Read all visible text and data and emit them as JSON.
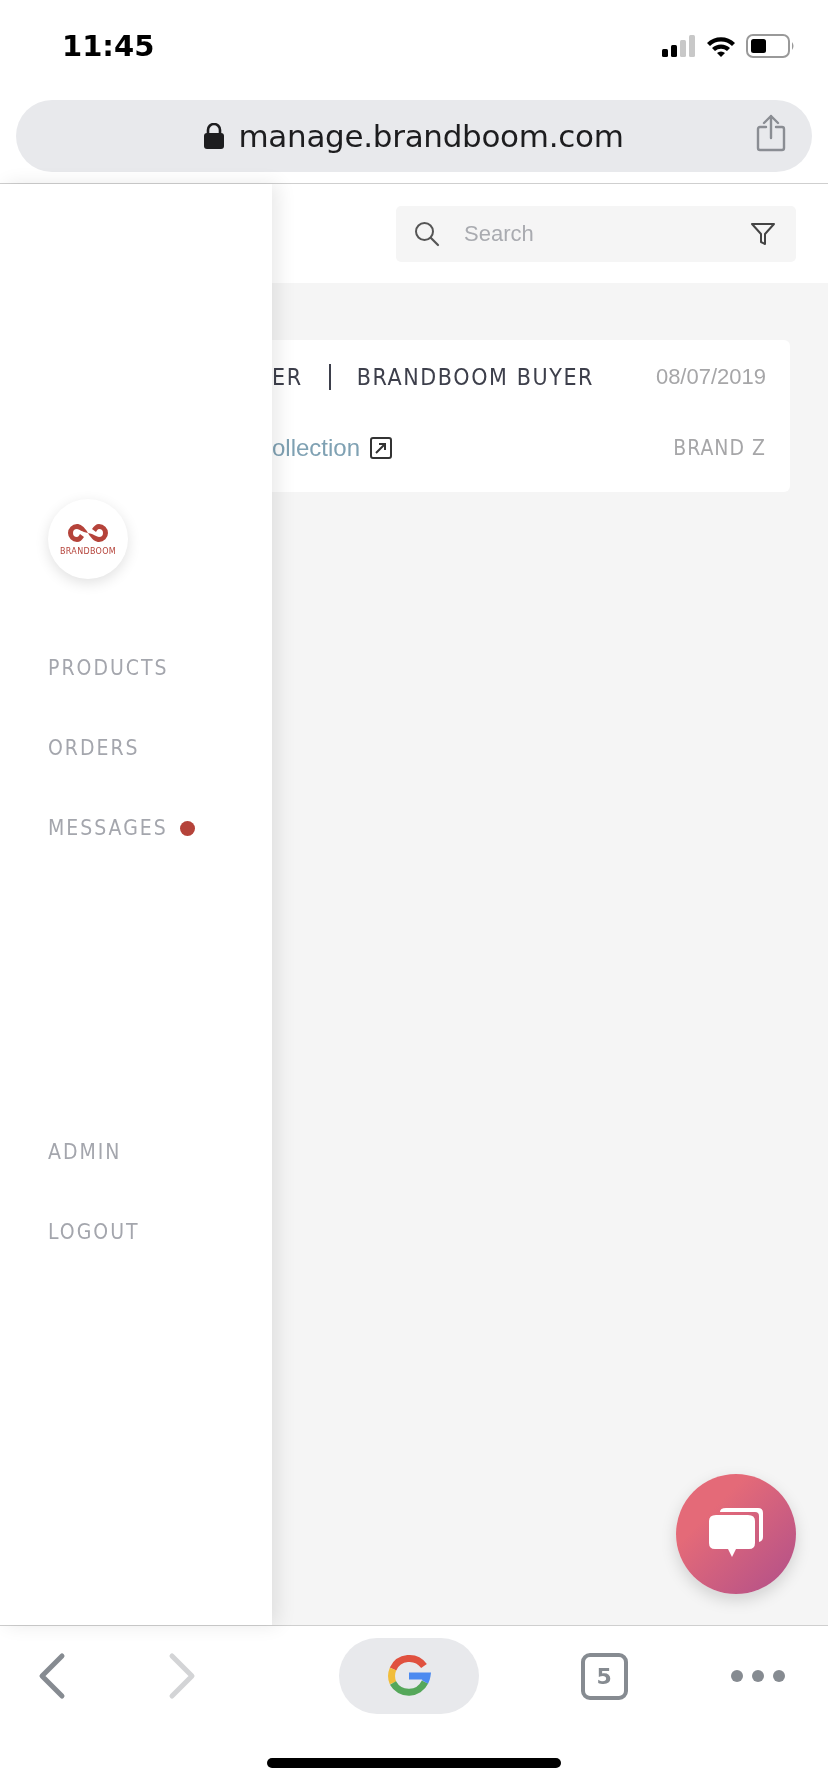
{
  "status_bar": {
    "time": "11:45"
  },
  "browser": {
    "url": "manage.brandboom.com",
    "tab_count": "5"
  },
  "search": {
    "placeholder": "Search"
  },
  "order": {
    "buyer_prefix": "ER",
    "buyer": "BRANDBOOM BUYER",
    "date": "08/07/2019",
    "collection": "ollection",
    "brand": "BRAND Z"
  },
  "sidebar": {
    "logo_text": "BRANDBOOM",
    "nav": [
      {
        "label": "PRODUCTS",
        "notification": false
      },
      {
        "label": "ORDERS",
        "notification": false
      },
      {
        "label": "MESSAGES",
        "notification": true
      }
    ],
    "footer_nav": [
      {
        "label": "ADMIN"
      },
      {
        "label": "LOGOUT"
      }
    ]
  }
}
